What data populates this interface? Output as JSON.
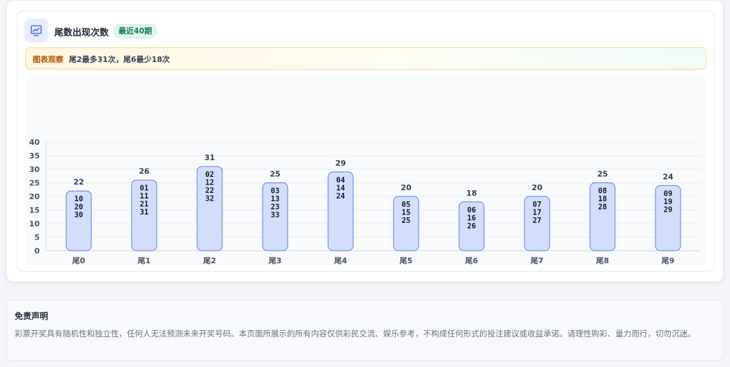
{
  "header": {
    "title": "尾数出现次数",
    "badge": "最近40期"
  },
  "observation": {
    "label": "图表观察",
    "text": "尾2最多31次，尾6最少18次"
  },
  "colors": {
    "bar_fill": "#d3defb",
    "bar_stroke": "#5b7fe0",
    "accent": "#4f6cf0",
    "badge_text": "#0f7a55"
  },
  "chart_data": {
    "type": "bar",
    "categories": [
      "尾0",
      "尾1",
      "尾2",
      "尾3",
      "尾4",
      "尾5",
      "尾6",
      "尾7",
      "尾8",
      "尾9"
    ],
    "values": [
      22,
      26,
      31,
      25,
      29,
      20,
      18,
      20,
      25,
      24
    ],
    "bar_numbers": [
      [
        "10",
        "20",
        "30"
      ],
      [
        "01",
        "11",
        "21",
        "31"
      ],
      [
        "02",
        "12",
        "22",
        "32"
      ],
      [
        "03",
        "13",
        "23",
        "33"
      ],
      [
        "04",
        "14",
        "24"
      ],
      [
        "05",
        "15",
        "25"
      ],
      [
        "06",
        "16",
        "26"
      ],
      [
        "07",
        "17",
        "27"
      ],
      [
        "08",
        "18",
        "28"
      ],
      [
        "09",
        "19",
        "29"
      ]
    ],
    "yticks": [
      0,
      5,
      10,
      15,
      20,
      25,
      30,
      35,
      40
    ],
    "ylim": [
      0,
      40
    ],
    "grid": true,
    "title": "",
    "xlabel": "",
    "ylabel": ""
  },
  "disclaimer": {
    "title": "免责声明",
    "text": "彩票开奖具有随机性和独立性，任何人无法预测未来开奖号码。本页面所展示的所有内容仅供彩民交流、娱乐参考，不构成任何形式的投注建议或收益承诺。请理性购彩、量力而行，切勿沉迷。"
  }
}
